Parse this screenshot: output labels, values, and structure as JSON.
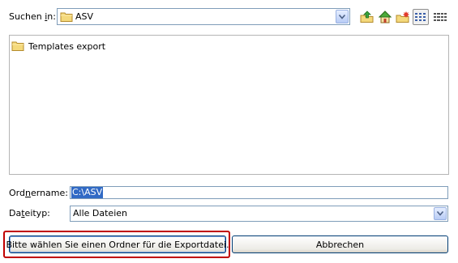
{
  "top": {
    "look_in_label_pre": "Suchen ",
    "look_in_label_key": "i",
    "look_in_label_post": "n:",
    "folder_value": "ASV",
    "toolbar_icons": [
      "up-folder-icon",
      "home-icon",
      "new-folder-icon",
      "list-view-icon",
      "details-view-icon"
    ]
  },
  "filelist": {
    "items": [
      {
        "name": "Templates export",
        "icon": "folder-icon"
      }
    ]
  },
  "fields": {
    "folder_name_label_pre": "Ord",
    "folder_name_label_key": "n",
    "folder_name_label_post": "ername:",
    "folder_name_value": "C:\\ASV",
    "file_type_label_pre": "Da",
    "file_type_label_key": "t",
    "file_type_label_post": "eityp:",
    "file_type_value": "Alle Dateien"
  },
  "buttons": {
    "select_label": "Bitte wählen Sie einen Ordner für die Exportdatei.",
    "cancel_label": "Abbrechen"
  },
  "colors": {
    "selection": "#316ac5",
    "highlight_border": "#c00000",
    "field_border": "#7f9db9"
  }
}
